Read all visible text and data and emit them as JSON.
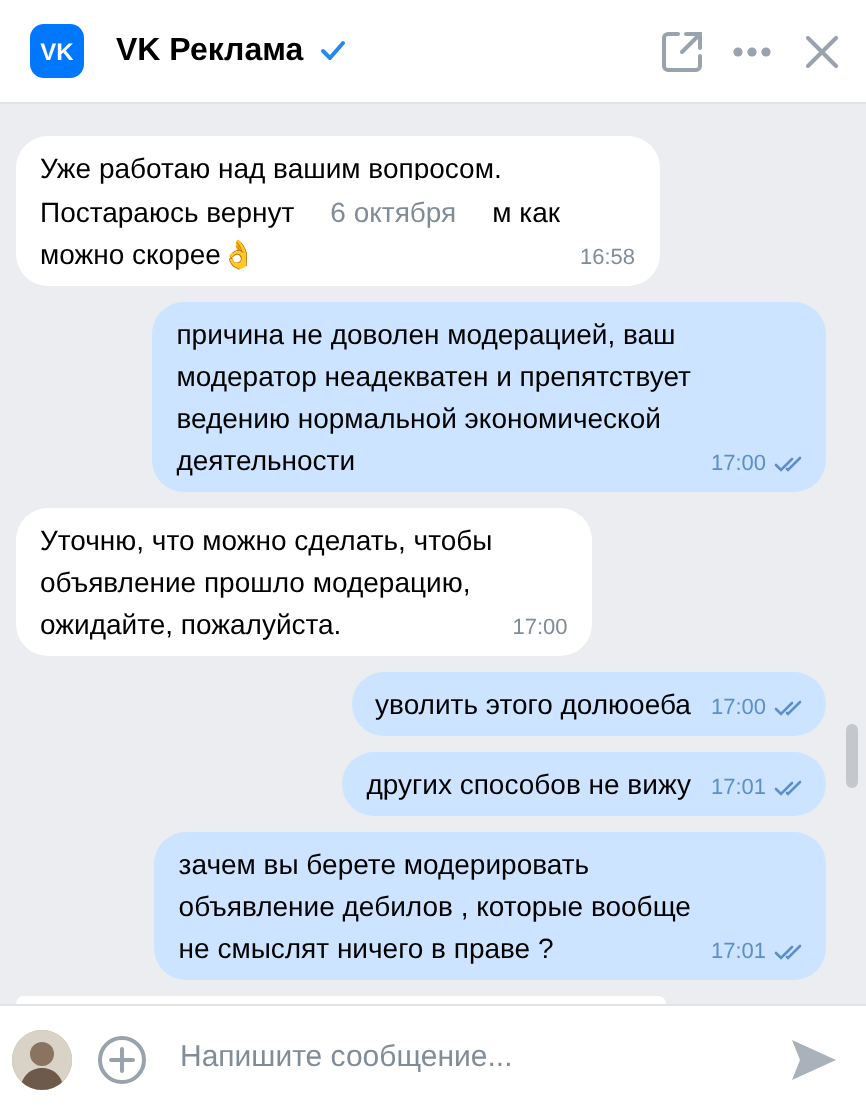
{
  "header": {
    "logo_text": "VK",
    "title": "VK Реклама",
    "verified": true
  },
  "messages": [
    {
      "kind": "incoming",
      "read": false,
      "lines": [
        "Уже работаю над вашим вопросом.",
        {
          "before": "Постараюсь вернут",
          "date": "6 октября",
          "after": "м как"
        },
        "можно скорее👌"
      ],
      "time": "16:58"
    },
    {
      "kind": "outgoing",
      "read": true,
      "lines": [
        "причина не доволен модерацией, ваш",
        "модератор неадекватен и препятствует",
        "ведению нормальной экономической",
        "деятельности"
      ],
      "time": "17:00"
    },
    {
      "kind": "incoming",
      "read": false,
      "lines": [
        "Уточню, что можно сделать, чтобы",
        "объявление прошло модерацию,",
        "ожидайте, пожалуйста."
      ],
      "time": "17:00"
    },
    {
      "kind": "outgoing",
      "read": true,
      "lines": [
        "уволить этого долюоеба"
      ],
      "time": "17:00"
    },
    {
      "kind": "outgoing",
      "read": true,
      "lines": [
        "других способов не вижу"
      ],
      "time": "17:01"
    },
    {
      "kind": "outgoing",
      "read": true,
      "lines": [
        "зачем вы берете модерировать",
        "объявление дебилов , которые вообще",
        "не смыслят ничего в праве ?"
      ],
      "time": "17:01"
    }
  ],
  "composer": {
    "placeholder": "Напишите сообщение..."
  }
}
